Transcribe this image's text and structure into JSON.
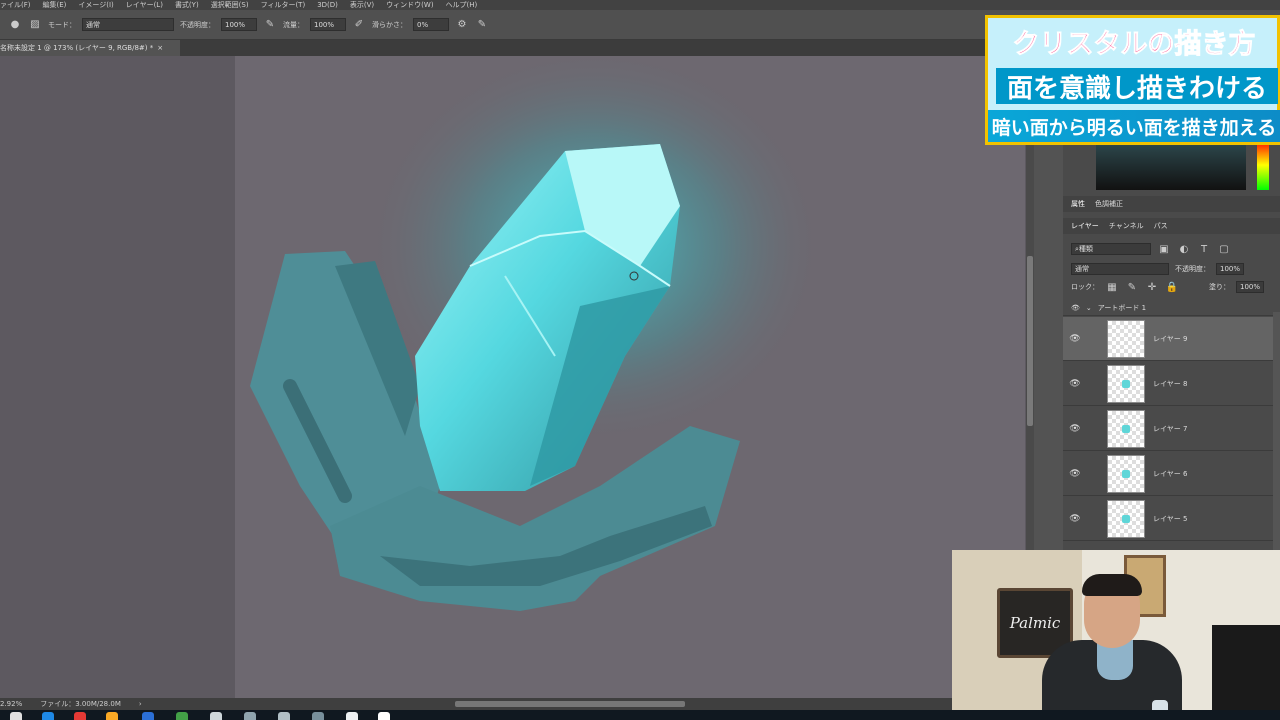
{
  "menubar": {
    "items": [
      "ァイル(F)",
      "編集(E)",
      "イメージ(I)",
      "レイヤー(L)",
      "書式(Y)",
      "選択範囲(S)",
      "フィルター(T)",
      "3D(D)",
      "表示(V)",
      "ウィンドウ(W)",
      "ヘルプ(H)"
    ]
  },
  "options": {
    "mode_label": "モード：",
    "mode_value": "通常",
    "opacity_label": "不透明度：",
    "opacity_value": "100%",
    "flow_label": "流量：",
    "flow_value": "100%",
    "smoothing_label": "滑らかさ：",
    "smoothing_value": "0%"
  },
  "document": {
    "tab_title": "名称未設定 1 @ 173% (レイヤー 9, RGB/8#) *",
    "close": "×"
  },
  "status": {
    "zoom": "2.92%",
    "file_info": "ファイル：3.00M/28.0M",
    "arrow": "›"
  },
  "panel": {
    "props_tabs": [
      "属性",
      "色調補正"
    ],
    "layer_tabs": [
      "レイヤー",
      "チャンネル",
      "パス"
    ],
    "filter_kind": "種類",
    "blend_mode": "通常",
    "opacity_label": "不透明度：",
    "opacity_value": "100%",
    "lock_label": "ロック：",
    "fill_label": "塗り：",
    "fill_value": "100%",
    "artboard_name": "アートボード 1",
    "layers": [
      {
        "name": "レイヤー 9",
        "selected": true
      },
      {
        "name": "レイヤー 8",
        "selected": false
      },
      {
        "name": "レイヤー 7",
        "selected": false
      },
      {
        "name": "レイヤー 6",
        "selected": false
      },
      {
        "name": "レイヤー 5",
        "selected": false
      }
    ]
  },
  "overlay": {
    "title": "クリスタルの描き方",
    "subtitle": "面を意識し描きわける",
    "band": "暗い面から明るい面を描き加える"
  },
  "webcam": {
    "board_text": "Palmic"
  },
  "colors": {
    "crystal_light": "#7fe9ee",
    "crystal_mid": "#46b8c2",
    "crystal_dark": "#3c7b83",
    "glow": "#3fe0e6",
    "title_pink": "#ff2d78",
    "banner_blue": "#0097c9"
  }
}
